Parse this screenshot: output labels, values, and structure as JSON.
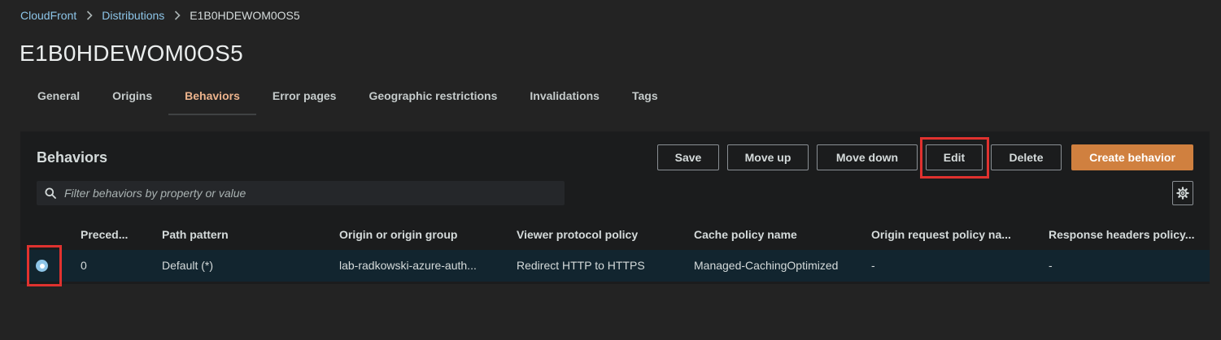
{
  "breadcrumb": {
    "items": [
      "CloudFront",
      "Distributions"
    ],
    "current": "E1B0HDEWOM0OS5"
  },
  "page": {
    "title": "E1B0HDEWOM0OS5"
  },
  "tabs": [
    {
      "label": "General"
    },
    {
      "label": "Origins"
    },
    {
      "label": "Behaviors",
      "active": true
    },
    {
      "label": "Error pages"
    },
    {
      "label": "Geographic restrictions"
    },
    {
      "label": "Invalidations"
    },
    {
      "label": "Tags"
    }
  ],
  "behaviors": {
    "title": "Behaviors",
    "buttons": {
      "save": "Save",
      "move_up": "Move up",
      "move_down": "Move down",
      "edit": "Edit",
      "delete": "Delete",
      "create": "Create behavior"
    },
    "filter": {
      "placeholder": "Filter behaviors by property or value",
      "value": ""
    },
    "columns": [
      "Preced...",
      "Path pattern",
      "Origin or origin group",
      "Viewer protocol policy",
      "Cache policy name",
      "Origin request policy na...",
      "Response headers policy..."
    ],
    "rows": [
      {
        "selected": true,
        "precedence": "0",
        "path_pattern": "Default (*)",
        "origin": "lab-radkowski-azure-auth...",
        "viewer_protocol_policy": "Redirect HTTP to HTTPS",
        "cache_policy": "Managed-CachingOptimized",
        "origin_request_policy": "-",
        "response_headers_policy": "-"
      }
    ]
  },
  "icons": {
    "breadcrumb_separator": "chevron-right-icon",
    "filter": "search-icon",
    "settings": "gear-icon"
  },
  "colors": {
    "background": "#232323",
    "panel": "#1b1c1d",
    "link": "#8dc5e8",
    "active_tab": "#ecb38c",
    "primary_button": "#d0803f",
    "selected_row": "#12252f",
    "highlight": "#e0322f"
  }
}
